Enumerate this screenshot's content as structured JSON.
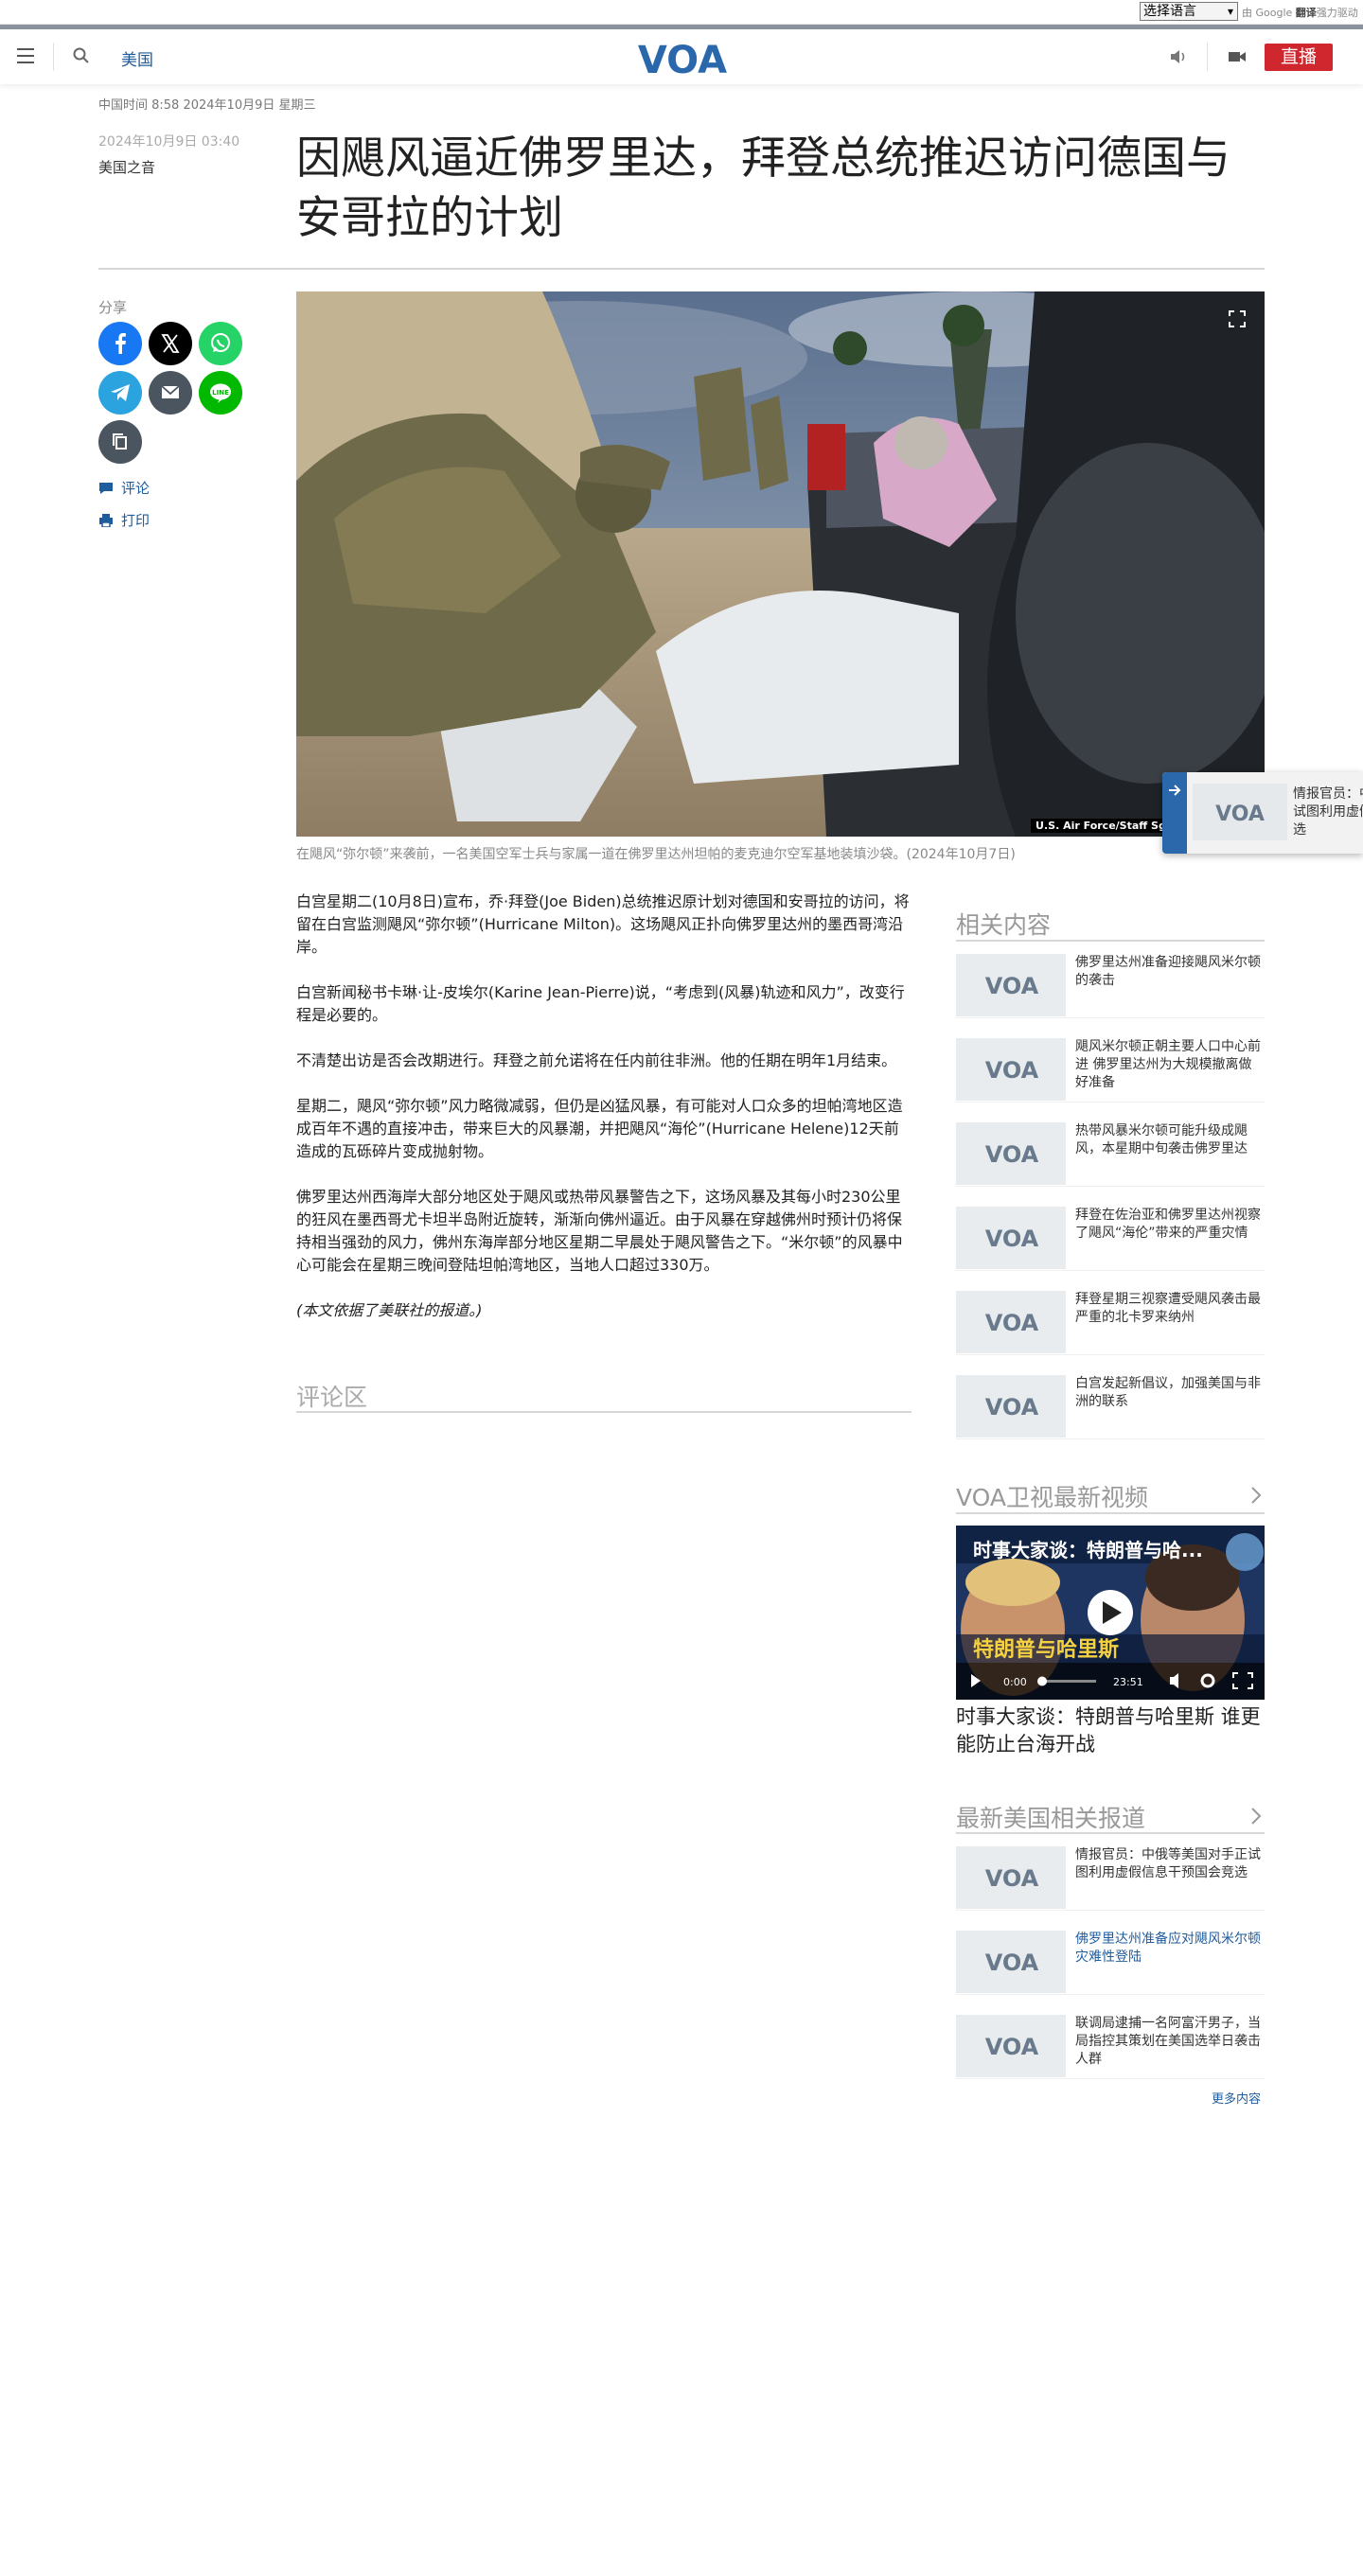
{
  "translate": {
    "select_label": "选择语言",
    "powered_prefix": "由",
    "google": "Google",
    "translate_word": "翻译",
    "powered_suffix": "强力驱动"
  },
  "header": {
    "section": "美国",
    "logo": "VOA",
    "live": "直播"
  },
  "article": {
    "time_line": "中国时间 8:58 2024年10月9日 星期三",
    "pub_date": "2024年10月9日 03:40",
    "author": "美国之音",
    "title": "因飓风逼近佛罗里达，拜登总统推迟访问德国与安哥拉的计划",
    "image_credit": "U.S. Air Force/Staff Sgt. Lauren Cobin",
    "caption": "在飓风“弥尔顿”来袭前，一名美国空军士兵与家属一道在佛罗里达州坦帕的麦克迪尔空军基地装填沙袋。(2024年10月7日)",
    "paragraphs": [
      "白宫星期二(10月8日)宣布，乔·拜登(Joe Biden)总统推迟原计划对德国和安哥拉的访问，将留在白宫监测飓风“弥尔顿”(Hurricane Milton)。这场飓风正扑向佛罗里达州的墨西哥湾沿岸。",
      "白宫新闻秘书卡琳·让-皮埃尔(Karine Jean-Pierre)说，“考虑到(风暴)轨迹和风力”，改变行程是必要的。",
      "不清楚出访是否会改期进行。拜登之前允诺将在任内前往非洲。他的任期在明年1月结束。",
      "星期二，飓风“弥尔顿”风力略微减弱，但仍是凶猛风暴，有可能对人口众多的坦帕湾地区造成百年不遇的直接冲击，带来巨大的风暴潮，并把飓风“海伦”(Hurricane Helene)12天前造成的瓦砾碎片变成抛射物。",
      "佛罗里达州西海岸大部分地区处于飓风或热带风暴警告之下，这场风暴及其每小时230公里的狂风在墨西哥尤卡坦半岛附近旋转，渐渐向佛州逼近。由于风暴在穿越佛州时预计仍将保持相当强劲的风力，佛州东海岸部分地区星期二早晨处于飓风警告之下。“米尔顿”的风暴中心可能会在星期三晚间登陆坦帕湾地区，当地人口超过330万。"
    ],
    "source_note": "(本文依据了美联社的报道。)"
  },
  "share": {
    "label": "分享",
    "comment": "评论",
    "print": "打印"
  },
  "comments": {
    "title": "评论区"
  },
  "related": {
    "title": "相关内容",
    "items": [
      "佛罗里达州准备迎接飓风米尔顿的袭击",
      "飓风米尔顿正朝主要人口中心前进 佛罗里达州为大规模撤离做好准备",
      "热带风暴米尔顿可能升级成飓风，本星期中旬袭击佛罗里达",
      "拜登在佐治亚和佛罗里达州视察了飓风“海伦”带来的严重灾情",
      "拜登星期三视察遭受飓风袭击最严重的北卡罗来纳州",
      "白宫发起新倡议，加强美国与非洲的联系"
    ]
  },
  "tv": {
    "title": "VOA卫视最新视频",
    "overlay_title": "时事大家谈：特朗普与哈...",
    "banner_text": "特朗普与哈里斯",
    "time_current": "0:00",
    "time_total": "23:51",
    "caption": "时事大家谈：特朗普与哈里斯 谁更能防止台海开战"
  },
  "latest": {
    "title": "最新美国相关报道",
    "items": [
      {
        "text": "情报官员：中俄等美国对手正试图利用虚假信息干预国会竞选",
        "highlight": false
      },
      {
        "text": "佛罗里达州准备应对飓风米尔顿灾难性登陆",
        "highlight": true
      },
      {
        "text": "联调局逮捕一名阿富汗男子，当局指控其策划在美国选举日袭击人群",
        "highlight": false
      }
    ],
    "more": "更多内容"
  },
  "float_card": {
    "text": "情报官员：中俄等美国对手正试图利用虚假信息干预国会竞选"
  },
  "colors": {
    "brand_blue": "#1f5c9e",
    "live_red": "#d0262d",
    "logo_blue": "#2a68ab"
  }
}
